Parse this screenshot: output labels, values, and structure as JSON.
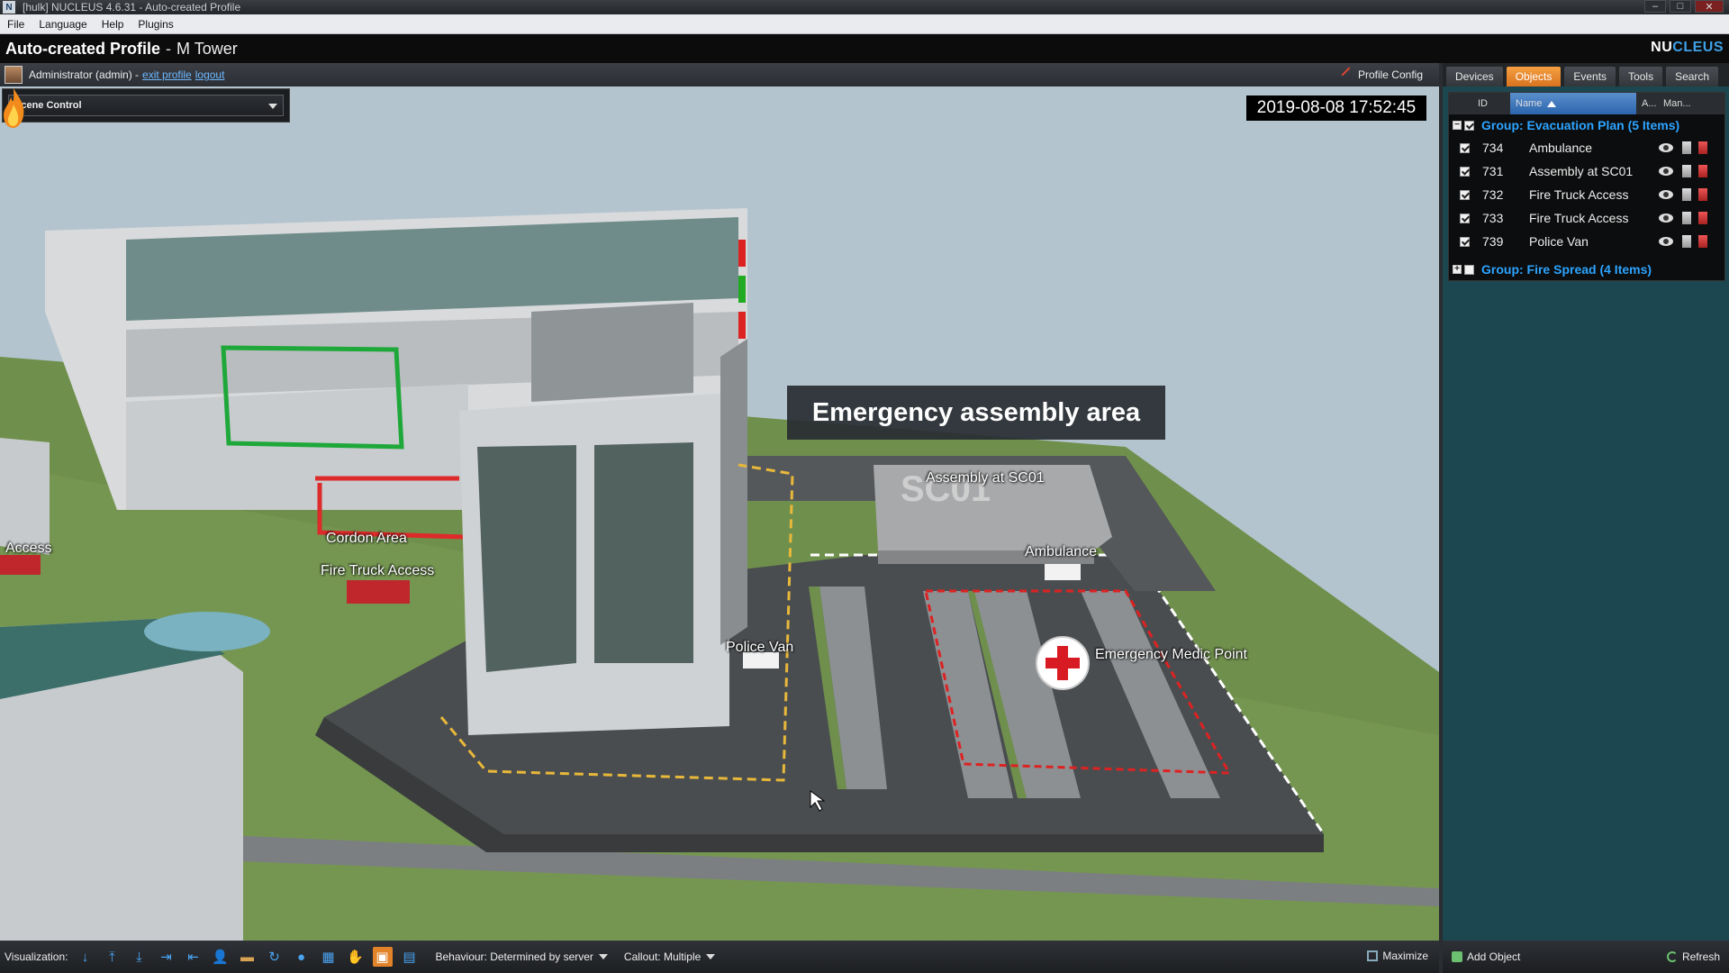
{
  "window": {
    "title": "[hulk] NUCLEUS 4.6.31 - Auto-created Profile",
    "app_icon": "N",
    "controls": {
      "minimize": "‒",
      "maximize": "□",
      "close": "✕"
    }
  },
  "menu": {
    "items": [
      "File",
      "Language",
      "Help",
      "Plugins"
    ]
  },
  "header": {
    "profile_name": "Auto-created Profile",
    "separator": "-",
    "site_name": "M Tower",
    "brand_nu": "NU",
    "brand_cleus": "CLEUS"
  },
  "userbar": {
    "user_text": "Administrator (admin) -",
    "exit_profile": "exit profile",
    "logout": "logout",
    "profile_config": "Profile Config"
  },
  "viewport": {
    "scene_control": "Scene Control",
    "timestamp": "2019-08-08 17:52:45",
    "banner": "Emergency assembly area",
    "labels": {
      "access": "Access",
      "cordon_area": "Cordon Area",
      "fire_truck_access": "Fire Truck Access",
      "assembly": "Assembly at SC01",
      "ambulance": "Ambulance",
      "police_van": "Police Van",
      "medic_point": "Emergency Medic Point",
      "ground_mark": "SC01"
    }
  },
  "bottombar": {
    "visualization_label": "Visualization:",
    "icons": [
      "arrow-down-icon",
      "arrow-top-icon",
      "arrow-bottom-icon",
      "arrow-right-end-icon",
      "arrow-left-end-icon",
      "person-icon",
      "folder-icon",
      "rotate-icon",
      "globe-icon",
      "grid-icon",
      "hand-icon",
      "box-icon",
      "map-icon"
    ],
    "behaviour": "Behaviour: Determined by server",
    "callout": "Callout: Multiple",
    "maximize": "Maximize"
  },
  "rightpanel": {
    "tabs": [
      {
        "label": "Devices",
        "active": false
      },
      {
        "label": "Objects",
        "active": true
      },
      {
        "label": "Events",
        "active": false
      },
      {
        "label": "Tools",
        "active": false
      },
      {
        "label": "Search",
        "active": false
      }
    ],
    "columns": {
      "id": "ID",
      "name": "Name",
      "a": "A...",
      "man": "Man..."
    },
    "groups": [
      {
        "title": "Group: Evacuation Plan (5 Items)",
        "expanded": true,
        "checked": true,
        "items": [
          {
            "id": "734",
            "name": "Ambulance"
          },
          {
            "id": "731",
            "name": "Assembly at SC01"
          },
          {
            "id": "732",
            "name": "Fire Truck Access"
          },
          {
            "id": "733",
            "name": "Fire Truck Access"
          },
          {
            "id": "739",
            "name": "Police Van"
          }
        ]
      },
      {
        "title": "Group: Fire Spread (4 Items)",
        "expanded": false,
        "checked": false,
        "items": []
      }
    ],
    "add_object": "Add Object",
    "refresh": "Refresh"
  },
  "colors": {
    "accent_orange": "#e2832a",
    "group_blue": "#2da4ff",
    "panel_teal": "#1d4750",
    "cross_red": "#d81b22"
  }
}
